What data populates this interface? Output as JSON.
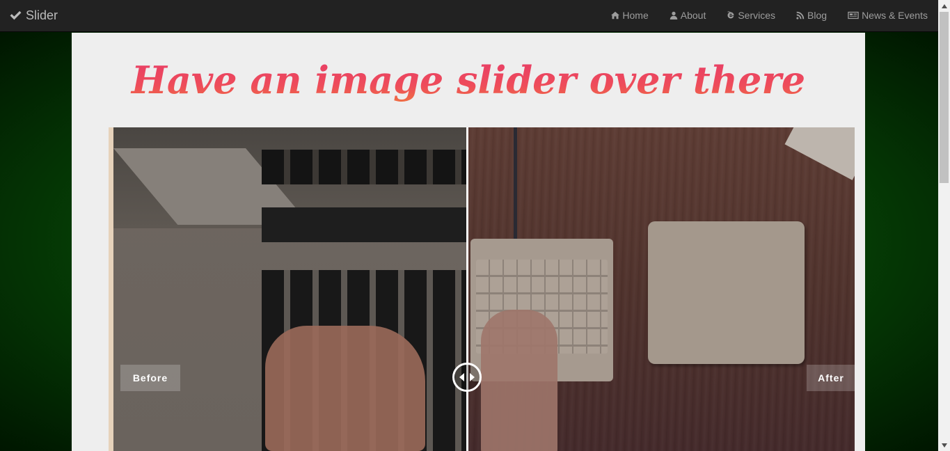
{
  "navbar": {
    "brand": "Slider",
    "brand_icon": "checkmark-icon",
    "items": [
      {
        "label": "Home",
        "icon": "home-icon"
      },
      {
        "label": "About",
        "icon": "user-icon"
      },
      {
        "label": "Services",
        "icon": "internet-explorer-icon"
      },
      {
        "label": "Blog",
        "icon": "rss-icon"
      },
      {
        "label": "News & Events",
        "icon": "newspaper-icon"
      }
    ]
  },
  "headline": "Have an image slider over there",
  "slider": {
    "before_label": "Before",
    "after_label": "After",
    "position": 0.48
  },
  "colors": {
    "navbar_bg": "#222222",
    "nav_text": "#9d9d9d",
    "panel_bg": "#eeeeee",
    "headline_gradient_top": "#e63a6a",
    "headline_gradient_bottom": "#f07a3c",
    "page_bg": "#0a5c0a"
  }
}
